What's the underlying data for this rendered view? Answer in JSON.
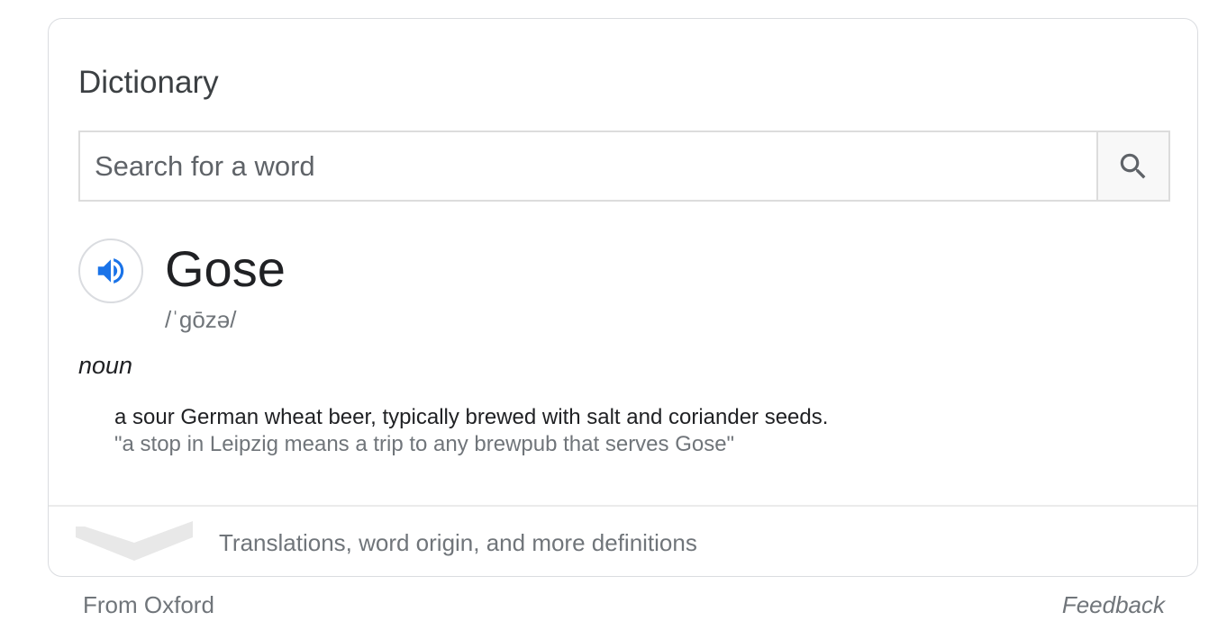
{
  "card": {
    "title": "Dictionary"
  },
  "search": {
    "placeholder": "Search for a word",
    "value": "",
    "button_icon": "search-icon"
  },
  "entry": {
    "audio_icon": "speaker-icon",
    "word": "Gose",
    "phonetic": "/ˈɡōzə/",
    "part_of_speech": "noun",
    "definition": "a sour German wheat beer, typically brewed with salt and coriander seeds.",
    "example": "\"a stop in Leipzig means a trip to any brewpub that serves Gose\""
  },
  "expander": {
    "icon": "chevron-down-icon",
    "label": "Translations, word origin, and more definitions"
  },
  "footer": {
    "source": "From Oxford",
    "feedback": "Feedback"
  },
  "colors": {
    "accent_blue": "#1a73e8",
    "border": "#dadce0",
    "secondary_text": "#70757a",
    "primary_text": "#202124"
  }
}
